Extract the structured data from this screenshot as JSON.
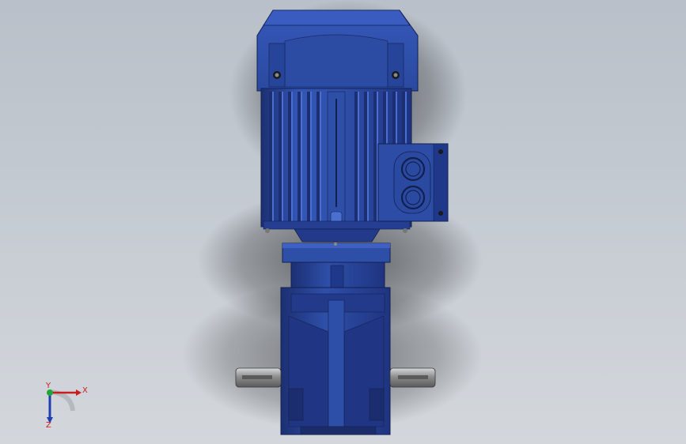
{
  "viewport": {
    "background_top": "#b9c0c9",
    "background_bottom": "#d3d7dc"
  },
  "model": {
    "part_color": "#2e4fa8",
    "part_shadow_color": "#1c2f72",
    "part_highlight_color": "#4a6fd0",
    "shaft_color": "#9a9a9a"
  },
  "triad": {
    "x_label": "X",
    "y_label": "Y",
    "z_label": "Z",
    "x_color": "#c81e1e",
    "y_color": "#1fa83a",
    "z_color": "#1f3fb0"
  }
}
